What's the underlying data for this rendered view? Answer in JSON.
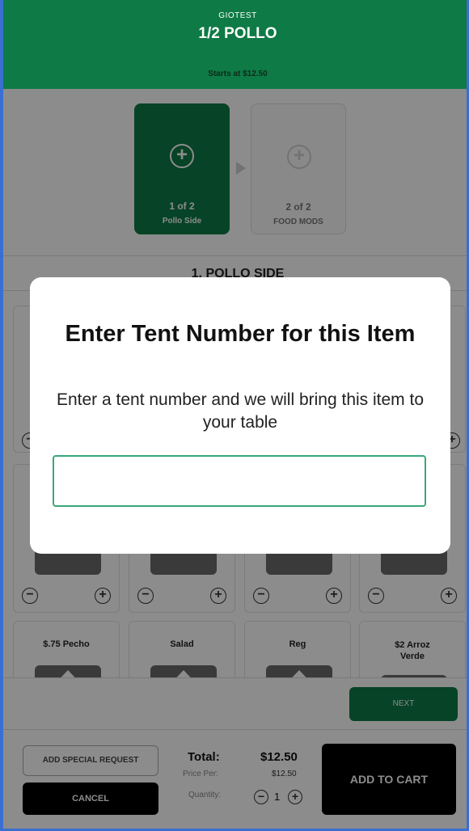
{
  "header": {
    "store_name": "GIOTEST",
    "item_title": "1/2 POLLO",
    "starts_at": "Starts at $12.50",
    "bg_color": "#0e7a45"
  },
  "steps": [
    {
      "number": "1 of 2",
      "name": "Pollo Side",
      "icon": "plus-circle-icon",
      "active": true
    },
    {
      "number": "2 of 2",
      "name": "FOOD MODS",
      "icon": "plus-circle-icon",
      "active": false
    }
  ],
  "section": {
    "title": "1. POLLO SIDE"
  },
  "options_row3": [
    {
      "label": "$.75 Pecho"
    },
    {
      "label": "Salad"
    },
    {
      "label": "Reg"
    },
    {
      "label": "$2 Arroz Verde"
    }
  ],
  "next_label": "NEXT",
  "footer": {
    "special_request_label": "ADD SPECIAL REQUEST",
    "cancel_label": "CANCEL",
    "total_label": "Total:",
    "total_value": "$12.50",
    "price_per_label": "Price Per:",
    "price_per_value": "$12.50",
    "quantity_label": "Quantity:",
    "quantity_value": "1",
    "add_to_cart_label": "ADD TO CART"
  },
  "modal": {
    "title": "Enter Tent Number for this Item",
    "subtitle": "Enter a tent number and we will bring this item to your table",
    "input_value": "",
    "input_border_color": "#3aa77a"
  }
}
